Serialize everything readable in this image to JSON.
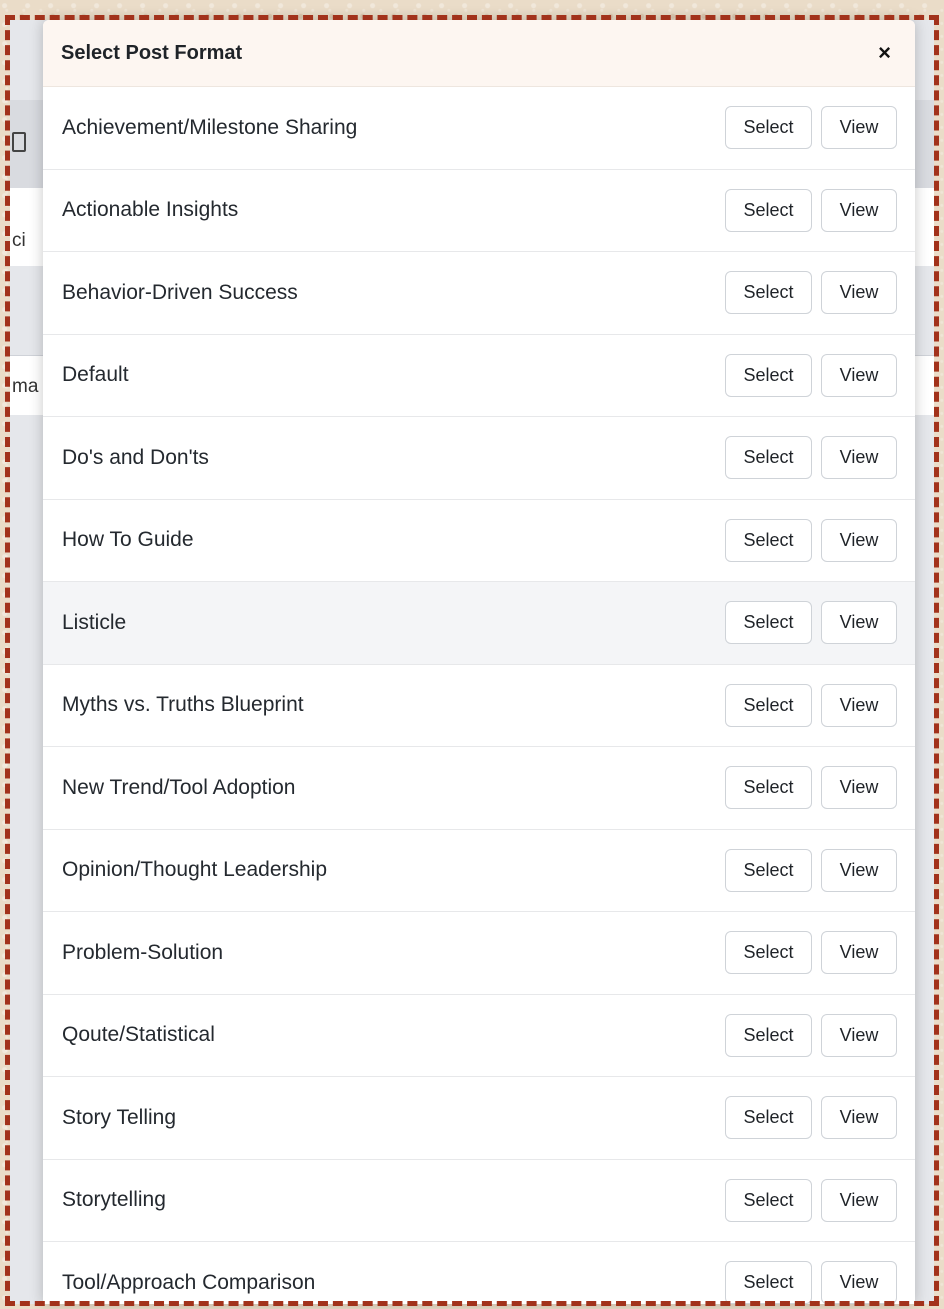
{
  "background": {
    "fragment_2": "ci",
    "fragment_3": "ma"
  },
  "modal": {
    "title": "Select Post Format",
    "close_icon": "×",
    "select_label": "Select",
    "view_label": "View",
    "formats": [
      "Achievement/Milestone Sharing",
      "Actionable Insights",
      "Behavior-Driven Success",
      "Default",
      "Do's and Don'ts",
      "How To Guide",
      "Listicle",
      "Myths vs. Truths Blueprint",
      "New Trend/Tool Adoption",
      "Opinion/Thought Leadership",
      "Problem-Solution",
      "Qoute/Statistical",
      "Story Telling",
      "Storytelling",
      "Tool/Approach Comparison"
    ],
    "highlighted_format": "Listicle"
  },
  "colors": {
    "frame_border": "#a2321b",
    "header_bg": "#fdf6f1",
    "highlight_row": "#f4f5f7"
  }
}
